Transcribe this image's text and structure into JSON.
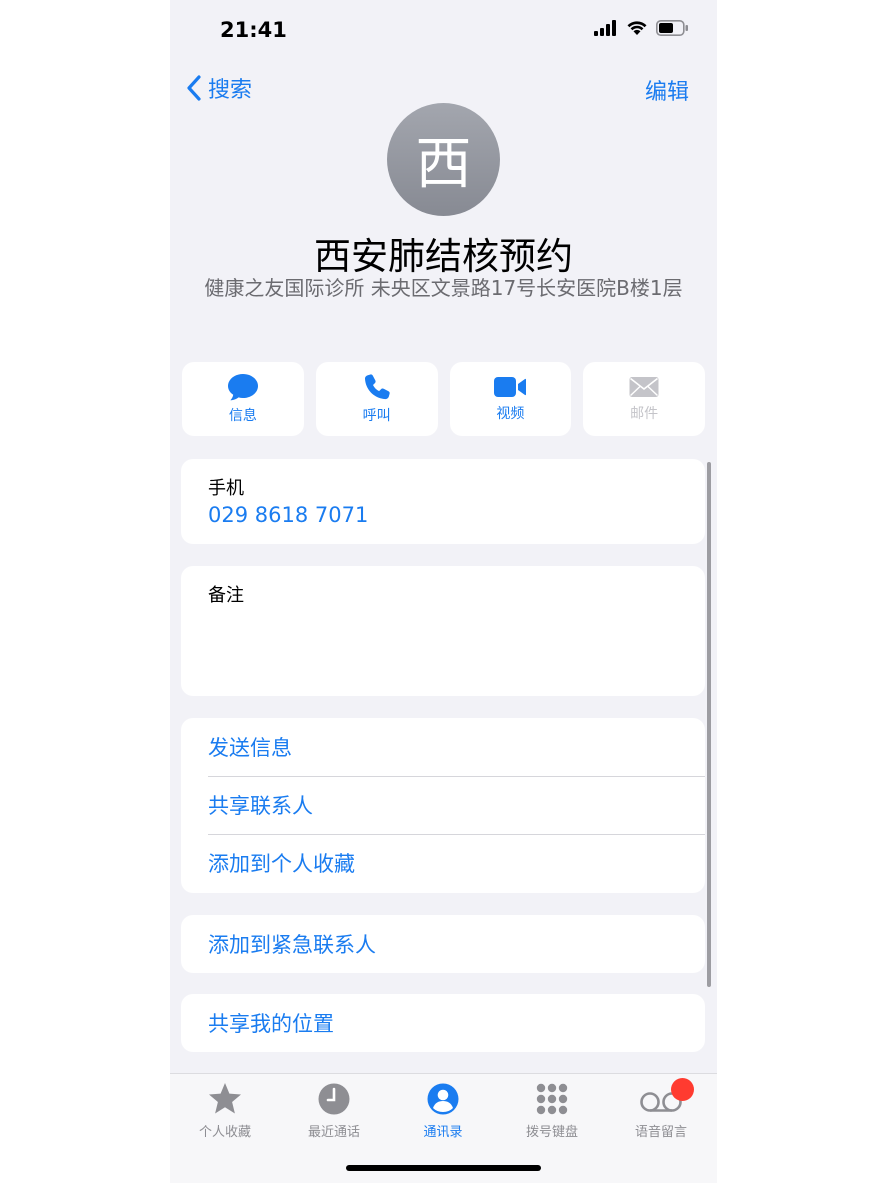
{
  "status_bar": {
    "time": "21:41",
    "icons": [
      "signal-icon",
      "wifi-icon",
      "battery-icon"
    ]
  },
  "nav": {
    "back_label": "搜索",
    "edit_label": "编辑"
  },
  "contact": {
    "avatar_initial": "西",
    "name": "西安肺结核预约",
    "subtitle": "健康之友国际诊所 未央区文景路17号长安医院B楼1层"
  },
  "actions": [
    {
      "label": "信息",
      "icon": "message-icon",
      "enabled": true
    },
    {
      "label": "呼叫",
      "icon": "phone-icon",
      "enabled": true
    },
    {
      "label": "视频",
      "icon": "video-icon",
      "enabled": true
    },
    {
      "label": "邮件",
      "icon": "mail-icon",
      "enabled": false
    }
  ],
  "phone_field": {
    "label": "手机",
    "value": "029 8618 7071"
  },
  "notes_field": {
    "label": "备注"
  },
  "options": [
    "发送信息",
    "共享联系人",
    "添加到个人收藏"
  ],
  "emergency": "添加到紧急联系人",
  "share_location": "共享我的位置",
  "tabbar": [
    {
      "label": "个人收藏",
      "icon": "star-icon",
      "active": false
    },
    {
      "label": "最近通话",
      "icon": "clock-icon",
      "active": false
    },
    {
      "label": "通讯录",
      "icon": "contacts-icon",
      "active": true
    },
    {
      "label": "拨号键盘",
      "icon": "keypad-icon",
      "active": false
    },
    {
      "label": "语音留言",
      "icon": "voicemail-icon",
      "active": false
    }
  ],
  "colors": {
    "accent": "#1a7cf0",
    "badge": "#ff3b30",
    "background": "#f2f2f7"
  }
}
